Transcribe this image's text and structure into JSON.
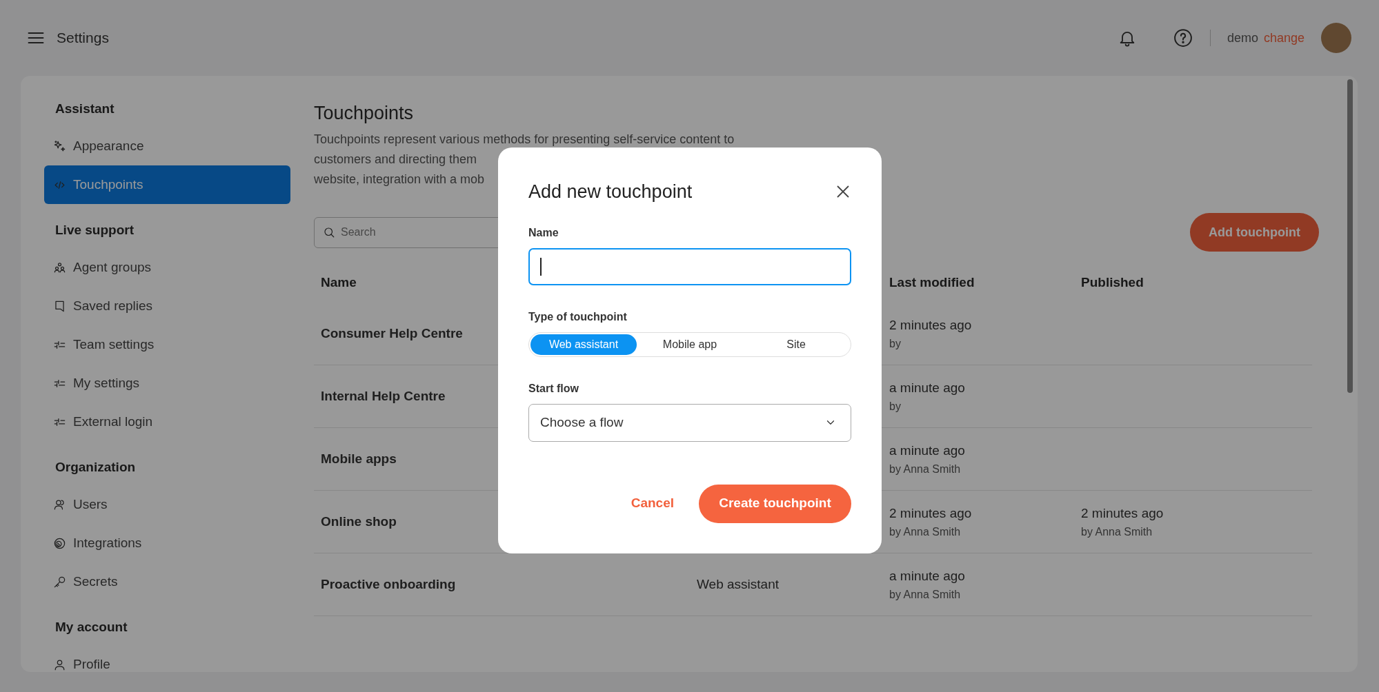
{
  "topbar": {
    "title": "Settings",
    "user": "demo",
    "change_link": "change"
  },
  "sidebar": {
    "sections": [
      {
        "title": "Assistant",
        "items": [
          {
            "label": "Appearance",
            "selected": false
          },
          {
            "label": "Touchpoints",
            "selected": true
          }
        ]
      },
      {
        "title": "Live support",
        "items": [
          {
            "label": "Agent groups",
            "selected": false
          },
          {
            "label": "Saved replies",
            "selected": false
          },
          {
            "label": "Team settings",
            "selected": false
          },
          {
            "label": "My settings",
            "selected": false
          },
          {
            "label": "External login",
            "selected": false
          }
        ]
      },
      {
        "title": "Organization",
        "items": [
          {
            "label": "Users",
            "selected": false
          },
          {
            "label": "Integrations",
            "selected": false
          },
          {
            "label": "Secrets",
            "selected": false
          }
        ]
      },
      {
        "title": "My account",
        "items": [
          {
            "label": "Profile",
            "selected": false
          }
        ]
      }
    ]
  },
  "page": {
    "title": "Touchpoints",
    "description_lines": [
      "Touchpoints represent various methods for presenting self-service content to",
      "customers and directing them",
      "website, integration with a mob"
    ],
    "search": {
      "placeholder": "Search"
    },
    "add_button": "Add touchpoint"
  },
  "table": {
    "columns": [
      "Name",
      "Last modified",
      "Published"
    ],
    "rows": [
      {
        "name": "Consumer Help Centre",
        "modified": "2 minutes ago",
        "modified_by": "by"
      },
      {
        "name": "Internal Help Centre",
        "modified": "a minute ago",
        "modified_by": "by"
      },
      {
        "name": "Mobile apps",
        "modified": "a minute ago",
        "modified_by": "by Anna Smith"
      },
      {
        "name": "Online shop",
        "modified": "2 minutes ago",
        "modified_by": "by Anna Smith",
        "published": "2 minutes ago",
        "published_by": "by Anna Smith"
      },
      {
        "name": "Proactive onboarding",
        "type": "Web assistant",
        "modified": "a minute ago",
        "modified_by": "by Anna Smith"
      }
    ]
  },
  "dialog": {
    "title": "Add new touchpoint",
    "name_label": "Name",
    "type_label": "Type of touchpoint",
    "types": [
      {
        "label": "Web assistant",
        "selected": true
      },
      {
        "label": "Mobile app",
        "selected": false
      },
      {
        "label": "Site",
        "selected": false
      }
    ],
    "flow_label": "Start flow",
    "flow": {
      "placeholder": "Choose a flow"
    },
    "cancel": "Cancel",
    "create": "Create touchpoint"
  }
}
